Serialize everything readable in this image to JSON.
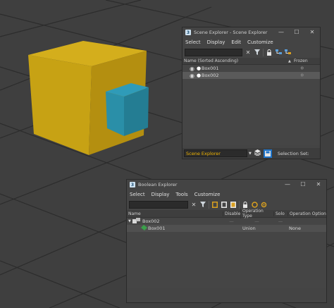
{
  "scene_explorer": {
    "title": "Scene Explorer - Scene Explorer",
    "menu": [
      "Select",
      "Display",
      "Edit",
      "Customize"
    ],
    "columns": {
      "name": "Name (Sorted Ascending)",
      "sort_arrow": "▲",
      "frozen": "Frozen"
    },
    "rows": [
      {
        "name": "Box001",
        "selected": false
      },
      {
        "name": "Box002",
        "selected": true
      }
    ],
    "explorer_dropdown": "Scene Explorer",
    "selection_set_label": "Selection Set:"
  },
  "boolean_explorer": {
    "title": "Boolean Explorer",
    "menu": [
      "Select",
      "Display",
      "Tools",
      "Customize"
    ],
    "columns": [
      "Name",
      "Disable",
      "Operation Type",
      "Solo",
      "Operation Option"
    ],
    "rows": [
      {
        "name": "Box002",
        "disable": "—",
        "operation_type": "—",
        "solo": "—",
        "operation_option": ""
      },
      {
        "name": "Box001",
        "disable": "",
        "operation_type": "Union",
        "solo": "",
        "operation_option": "None"
      }
    ]
  },
  "window_controls": {
    "minimize": "—",
    "maximize": "☐",
    "close": "✕"
  },
  "icons": {
    "app_logo": "3",
    "visibility": "eye-icon",
    "clear": "close-icon",
    "filter": "filter-icon",
    "lock": "lock-icon",
    "layers": "layers-icon",
    "save": "disk-icon"
  },
  "colors": {
    "viewport_bg": "#3f3f3f",
    "grid": "#2e2e2e",
    "box_large": "#c9a61a",
    "box_small": "#2a8fa8",
    "panel_bg": "#444444",
    "accent_highlight": "#1e73c8",
    "dropdown_text": "#f0b400"
  }
}
